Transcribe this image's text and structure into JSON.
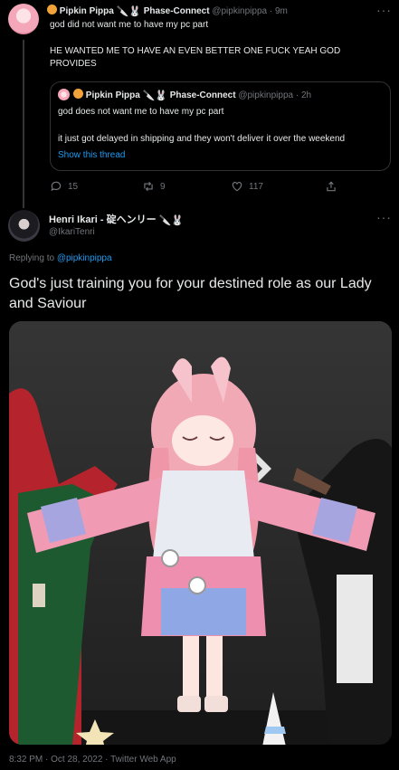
{
  "parent_tweet": {
    "display_name": "Pipkin Pippa",
    "affiliation": "Phase-Connect",
    "handle": "@pipkinpippa",
    "separator": "·",
    "time": "9m",
    "line1": "god did not want me to have my pc part",
    "line2": "HE WANTED ME TO HAVE AN EVEN BETTER ONE FUCK YEAH GOD PROVIDES",
    "replies": "15",
    "retweets": "9",
    "likes": "117",
    "more": "···"
  },
  "quoted_tweet": {
    "display_name": "Pipkin Pippa",
    "affiliation": "Phase-Connect",
    "handle": "@pipkinpippa",
    "separator": "·",
    "time": "2h",
    "line1": "god does not want me to have my pc part",
    "line2": "it just got delayed in shipping and they won't deliver it over the weekend",
    "show_thread": "Show this thread"
  },
  "main_tweet": {
    "display_name": "Henri Ikari - 碇ヘンリー",
    "handle": "@IkariTenri",
    "more": "···",
    "replying_prefix": "Replying to",
    "replying_to": "@pipkinpippa",
    "text": "God's just training you for your destined role as our Lady and Saviour",
    "timestamp": "8:32 PM · Oct 28, 2022 · Twitter Web App"
  },
  "colors": {
    "background": "#000000",
    "text": "#e7e9ea",
    "muted": "#71767b",
    "link": "#1d9bf0",
    "border": "#2f3336"
  }
}
